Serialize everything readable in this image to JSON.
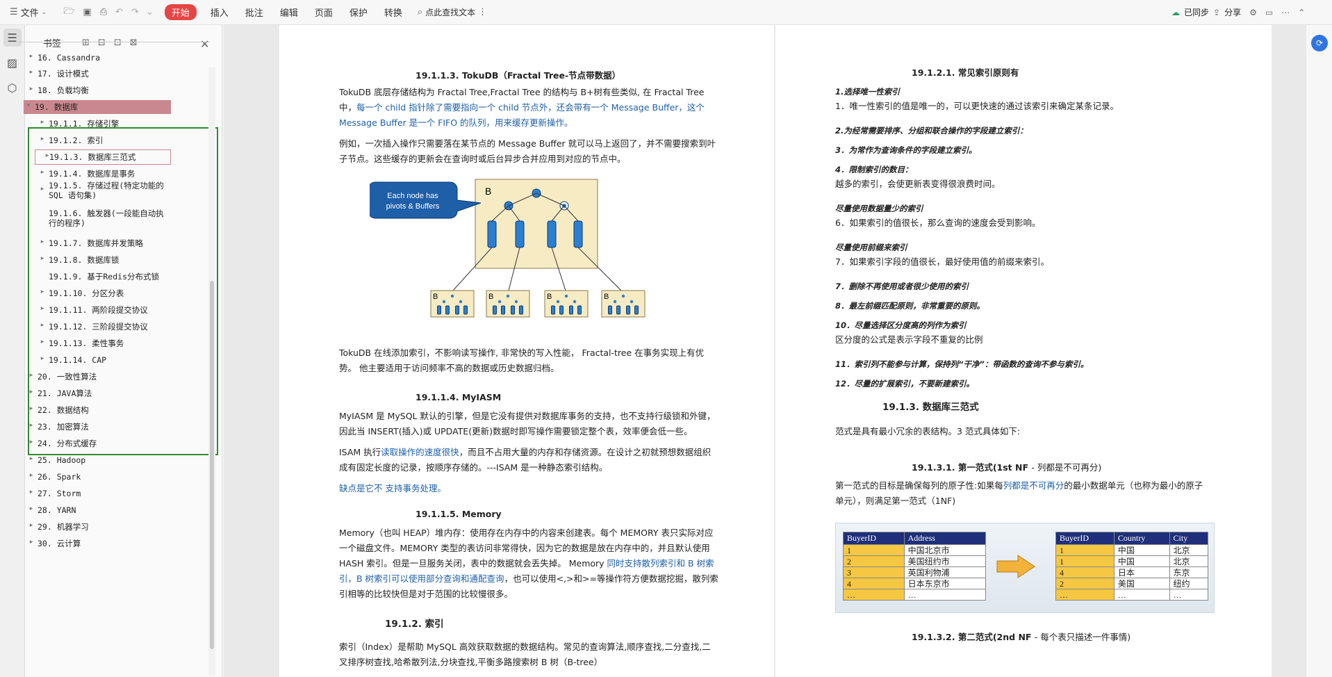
{
  "toolbar": {
    "file": "文件",
    "tabs": [
      "开始",
      "插入",
      "批注",
      "编辑",
      "页面",
      "保护",
      "转换"
    ],
    "search": "点此查找文本",
    "sync": "已同步",
    "share": "分享"
  },
  "panel": {
    "title": "书签",
    "items": [
      {
        "label": "16. Cassandra",
        "arrow": "▸"
      },
      {
        "label": "17. 设计模式",
        "arrow": "▸"
      },
      {
        "label": "18. 负载均衡",
        "arrow": "▸"
      },
      {
        "label": "19. 数据库",
        "arrow": "▾"
      },
      {
        "label": "19.1.1. 存储引擎",
        "arrow": "▸"
      },
      {
        "label": "19.1.2. 索引",
        "arrow": "▸"
      },
      {
        "label": "19.1.3. 数据库三范式",
        "arrow": "▸"
      },
      {
        "label": "19.1.4. 数据库是事务",
        "arrow": "▸"
      },
      {
        "label": "19.1.5. 存储过程(特定功能的SQL 语句集)",
        "arrow": "▸"
      },
      {
        "label": "19.1.6. 触发器(一段能自动执行的程序)",
        "arrow": ""
      },
      {
        "label": "19.1.7. 数据库并发策略",
        "arrow": "▸"
      },
      {
        "label": "19.1.8. 数据库锁",
        "arrow": "▸"
      },
      {
        "label": "19.1.9. 基于Redis分布式锁",
        "arrow": ""
      },
      {
        "label": "19.1.10. 分区分表",
        "arrow": "▸"
      },
      {
        "label": "19.1.11. 两阶段提交协议",
        "arrow": "▸"
      },
      {
        "label": "19.1.12. 三阶段提交协议",
        "arrow": "▸"
      },
      {
        "label": "19.1.13. 柔性事务",
        "arrow": "▸"
      },
      {
        "label": "19.1.14. CAP",
        "arrow": "▸"
      },
      {
        "label": "20. 一致性算法",
        "arrow": "▸"
      },
      {
        "label": "21. JAVA算法",
        "arrow": "▸"
      },
      {
        "label": "22. 数据结构",
        "arrow": "▸"
      },
      {
        "label": "23. 加密算法",
        "arrow": "▸"
      },
      {
        "label": "24. 分布式缓存",
        "arrow": "▸"
      },
      {
        "label": "25. Hadoop",
        "arrow": "▸"
      },
      {
        "label": "26. Spark",
        "arrow": "▸"
      },
      {
        "label": "27. Storm",
        "arrow": "▸"
      },
      {
        "label": "28. YARN",
        "arrow": "▸"
      },
      {
        "label": "29. 机器学习",
        "arrow": "▸"
      },
      {
        "label": "30. 云计算",
        "arrow": "▸"
      }
    ]
  },
  "left": {
    "h_tokudb": "19.1.1.3.   TokuDB（Fractal Tree-节点带数据）",
    "p1a": "TokuDB 底层存储结构为 Fractal Tree,Fractal Tree 的结构与 B+树有些类似, 在 Fractal Tree",
    "p1b_pre": "中，",
    "p1b_blue": "每一个 child 指针除了需要指向一个 child 节点外，还会带有一个 Message Buffer，这个",
    "p1c_blue": "Message Buffer 是一个 FIFO 的队列，用来缓存更新操作。",
    "p2a": "例如，一次插入操作只需要落在某节点的 Message Buffer 就可以马上返回了，并不需要搜索到叶",
    "p2b": "子节点。这些缓存的更新会在查询时或后台异步合并应用到对应的节点中。",
    "fig_callout": "Each node has pivots & Buffers",
    "fig_B": "B",
    "p3a": "TokuDB 在线添加索引，不影响读写操作, 非常快的写入性能， Fractal-tree 在事务实现上有优",
    "p3b": "势。 他主要适用于访问频率不高的数据或历史数据归档。",
    "h_myisam": "19.1.1.4.    MyIASM",
    "p4a": "MyIASM 是 MySQL 默认的引擎，但是它没有提供对数据库事务的支持，也不支持行级锁和外键，",
    "p4b": "因此当 INSERT(插入)或 UPDATE(更新)数据时即写操作需要锁定整个表，效率便会低一些。",
    "p5a_pre": "ISAM 执行",
    "p5a_blue": "读取操作的速度很快",
    "p5a_post": "，而且不占用大量的内存和存储资源。在设计之初就预想数据组织",
    "p5b": "成有固定长度的记录，按顺序存储的。---ISAM 是一种静态索引结构。",
    "p6_blue": "缺点是它不 支持事务处理。",
    "h_memory": "19.1.1.5.    Memory",
    "p7a": "Memory（也叫 HEAP）堆内存：使用存在内存中的内容来创建表。每个 MEMORY 表只实际对应",
    "p7b": "一个磁盘文件。MEMORY 类型的表访问非常得快，因为它的数据是放在内存中的，并且默认使用",
    "p7c_pre": "HASH 索引。但是一旦服务关闭，表中的数据就会丢失掉。 Memory ",
    "p7c_blue": "同时支持散列索引和 B 树索",
    "p7d_blue": "引，B 树索引可以使用部分查询和通配查询",
    "p7d_post": "，也可以使用<,>和>=等操作符方便数据挖掘，散列索",
    "p7e": "引相等的比较快但是对于范围的比较慢很多。",
    "h_index": "19.1.2.     索引",
    "p8a": "索引（Index）是帮助 MySQL 高效获取数据的数据结构。常见的查询算法,顺序查找,二分查找,二",
    "p8b": "叉排序树查找,哈希散列法,分块查找,平衡多路搜索树 B 树（B-tree）"
  },
  "right": {
    "h_rules": "19.1.2.1.    常见索引原则有",
    "r1": "1.选择唯一性索引",
    "r1t": "1．唯一性索引的值是唯一的，可以更快速的通过该索引来确定某条记录。",
    "r2": "2.为经常需要排序、分组和联合操作的字段建立索引：",
    "r3": "3．为常作为查询条件的字段建立索引。",
    "r4": "4．限制索引的数目：",
    "r4t": "越多的索引，会使更新表变得很浪费时间。",
    "r5": "尽量使用数据量少的索引",
    "r5t": "6．如果索引的值很长，那么查询的速度会受到影响。",
    "r6": "尽量使用前缀来索引",
    "r6t": "7．如果索引字段的值很长，最好使用值的前缀来索引。",
    "r7": "7．删除不再使用或者很少使用的索引",
    "r8": "8．最左前缀匹配原则，非常重要的原则。",
    "r10": "10．尽量选择区分度高的列作为索引",
    "r10t": "区分度的公式是表示字段不重复的比例",
    "r11": "11．索引列不能参与计算，保持列“干净”：带函数的查询不参与索引。",
    "r12": "12．尽量的扩展索引，不要新建索引。",
    "h_nf": "19.1.3.     数据库三范式",
    "nf_intro": "范式是具有最小冗余的表结构。3 范式具体如下:",
    "h_1nf_a": "19.1.3.1.    第一范式(1st NF ",
    "h_1nf_b": " - 列都是不可再分)",
    "p1nf_a_pre": "第一范式的目标是确保每列的原子性:如果每",
    "p1nf_a_blue": "列都是不可再分",
    "p1nf_a_post": "的最小数据单元（也称为最小的原子",
    "p1nf_b": "单元），则满足第一范式（1NF)",
    "t1_headers": [
      "BuyerID",
      "Address"
    ],
    "t1_rows": [
      [
        "1",
        "中国北京市"
      ],
      [
        "2",
        "美国纽约市"
      ],
      [
        "3",
        "英国利物浦"
      ],
      [
        "4",
        "日本东京市"
      ],
      [
        "…",
        "…"
      ]
    ],
    "t2_headers": [
      "BuyerID",
      "Country",
      "City"
    ],
    "t2_rows": [
      [
        "1",
        "中国",
        "北京"
      ],
      [
        "1",
        "中国",
        "北京"
      ],
      [
        "4",
        "日本",
        "东京"
      ],
      [
        "2",
        "美国",
        "纽约"
      ],
      [
        "…",
        "…",
        "…"
      ]
    ],
    "h_2nf_a": "19.1.3.2.    第二范式(2nd NF ",
    "h_2nf_b": "- 每个表只描述一件事情)"
  }
}
